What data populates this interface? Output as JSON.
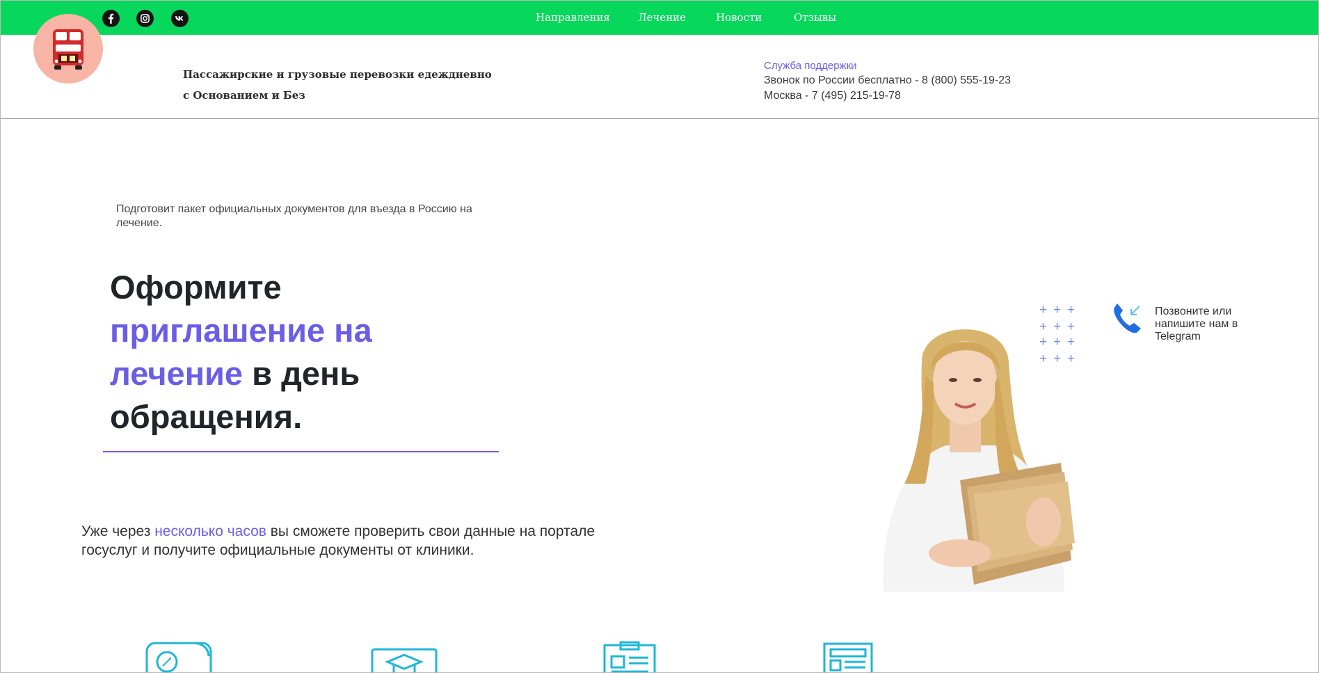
{
  "topbar": {
    "social": [
      "facebook-icon",
      "instagram-icon",
      "vk-icon"
    ],
    "nav": [
      "Направления",
      "Лечение",
      "Новости",
      "Отзывы"
    ],
    "bg_color": "#07d85c"
  },
  "header": {
    "tagline_line1": "Пассажирские и грузовые перевозки едеждневно",
    "tagline_line2": "с Основанием и Без",
    "support_title": "Служба поддержки",
    "phone_russia": "Звонок по России бесплатно - 8 (800) 555-19-23",
    "phone_moscow": "Москва - 7 (495) 215-19-78"
  },
  "hero": {
    "intro": "Подготовит пакет официальных документов для въезда в Россию на лечение.",
    "headline_part1": "Оформите ",
    "headline_accent": "приглашение на лечение",
    "headline_part2": " в день обращения.",
    "desc_part1": "Уже через ",
    "desc_link": "несколько часов",
    "desc_part2": " вы сможете проверить свои данные на портале госуслуг и получите официальные документы от клиники.",
    "accent_color": "#6a5ee6"
  },
  "contact": {
    "call_text": "Позвоните или напишите нам в Telegram"
  },
  "features": {
    "icons": [
      "discount-icon",
      "graduation-cap-icon",
      "clipboard-icon",
      "document-icon"
    ]
  }
}
